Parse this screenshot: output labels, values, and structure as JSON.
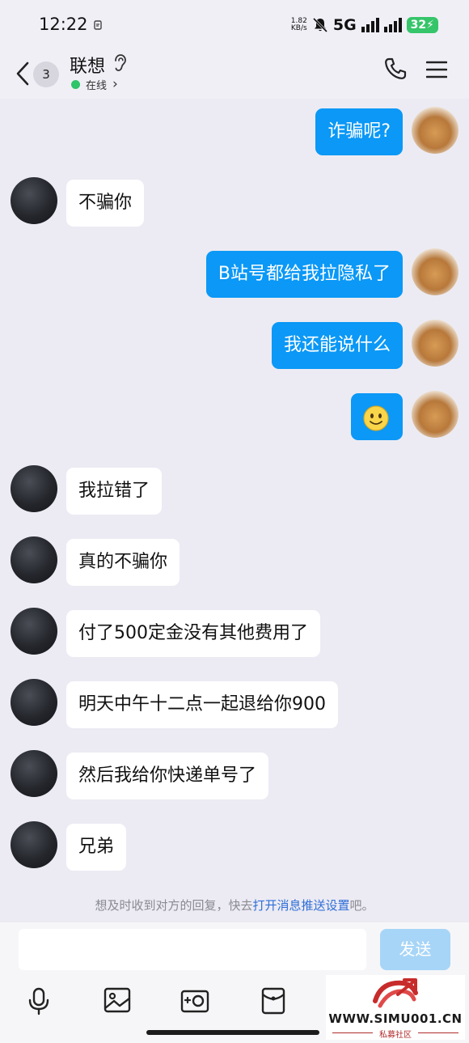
{
  "status_bar": {
    "time": "12:22",
    "net_speed_value": "1.82",
    "net_speed_unit": "KB/s",
    "network": "5G",
    "battery": "32"
  },
  "header": {
    "unread_count": "3",
    "contact_name": "联想",
    "status_text": "在线",
    "status_chevron": "›"
  },
  "messages": [
    {
      "side": "out",
      "text": "诈骗呢?"
    },
    {
      "side": "in",
      "text": "不骗你"
    },
    {
      "side": "out",
      "text": "B站号都给我拉隐私了"
    },
    {
      "side": "out",
      "text": "我还能说什么"
    },
    {
      "side": "out",
      "text": "",
      "emoji": "smiley-icon"
    },
    {
      "side": "in",
      "text": "我拉错了"
    },
    {
      "side": "in",
      "text": "真的不骗你"
    },
    {
      "side": "in",
      "text": "付了500定金没有其他费用了"
    },
    {
      "side": "in",
      "text": "明天中午十二点一起退给你900"
    },
    {
      "side": "in",
      "text": "然后我给你快递单号了"
    },
    {
      "side": "in",
      "text": "兄弟"
    }
  ],
  "hint": {
    "prefix": "想及时收到对方的回复，快去",
    "link": "打开消息推送设置",
    "suffix": "吧。"
  },
  "composer": {
    "input_value": "",
    "send_label": "发送"
  },
  "toolbar": [
    "microphone-icon",
    "image-icon",
    "camera-icon",
    "red-packet-icon"
  ],
  "watermark": {
    "text": "WWW.SIMU001.CN",
    "subtext": "私募社区"
  },
  "colors": {
    "outgoing_bubble": "#0b98f6",
    "incoming_bubble": "#ffffff",
    "background": "#ecebf3",
    "online_dot": "#2ec46a",
    "send_button_disabled": "#a7d5f7",
    "hint_link": "#2f6ed8"
  }
}
